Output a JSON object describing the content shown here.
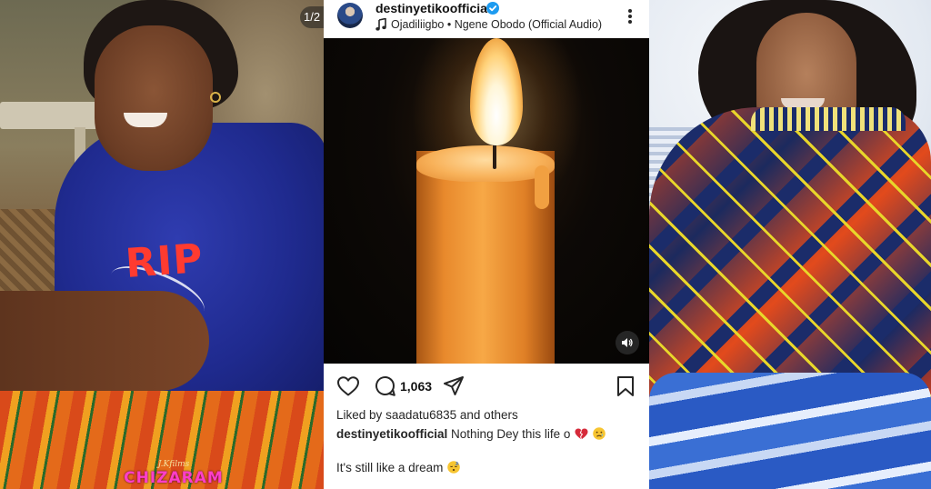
{
  "left_panel": {
    "overlay_text": "RIP",
    "image_counter": "1/2",
    "watermark_small": "J.Kfilms",
    "watermark_large": "CHIZARAM",
    "accent_color": "#ff3b30"
  },
  "post": {
    "username": "destinyetikoofficial",
    "verified": true,
    "audio": "Ojadiliigbo • Ngene Obodo (Official Audio)",
    "icons": {
      "music": "music-note-icon",
      "more": "more-options-icon",
      "sound": "sound-on-icon",
      "like": "heart-icon",
      "comment": "comment-icon",
      "share": "share-icon",
      "save": "bookmark-icon"
    },
    "comment_count": "1,063",
    "liked_by_prefix": "Liked by",
    "liked_by_user": "saadatu6835",
    "liked_by_suffix": "and others",
    "caption_user": "destinyetikoofficial",
    "caption_text": "Nothing Dey this life o",
    "caption_emojis": [
      "broken-heart",
      "crying-face"
    ],
    "caption_line2": "It's still like a dream",
    "caption_line2_emoji": "sleeping-face",
    "verified_color": "#1d9bf0"
  }
}
